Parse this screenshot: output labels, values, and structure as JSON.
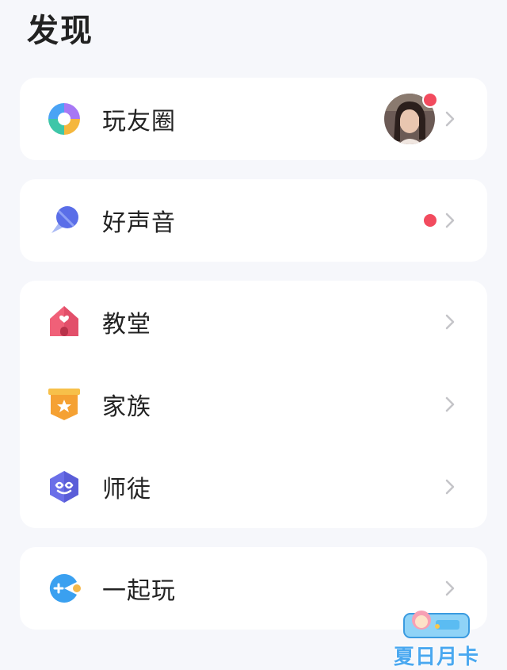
{
  "header": {
    "title": "发现"
  },
  "groups": [
    {
      "items": [
        {
          "label": "玩友圈",
          "has_avatar": true,
          "has_dot": true
        }
      ]
    },
    {
      "items": [
        {
          "label": "好声音",
          "has_dot": true
        }
      ]
    },
    {
      "items": [
        {
          "label": "教堂"
        },
        {
          "label": "家族"
        },
        {
          "label": "师徒"
        }
      ]
    },
    {
      "items": [
        {
          "label": "一起玩"
        }
      ]
    }
  ],
  "floating_badge": {
    "text": "夏日月卡"
  },
  "colors": {
    "background": "#f6f7fb",
    "card": "#ffffff",
    "text": "#222222",
    "red_dot": "#f24b5e",
    "chevron": "#c4c4c8"
  }
}
